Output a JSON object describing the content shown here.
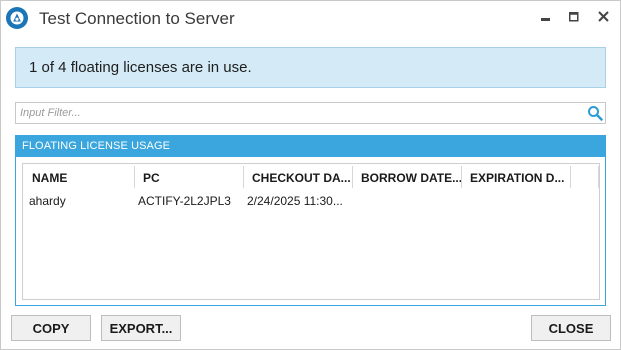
{
  "window": {
    "title": "Test Connection to Server",
    "icons": {
      "app": "actify-logo-icon",
      "minimize": "minimize-icon",
      "maximize": "maximize-icon",
      "close": "close-icon"
    }
  },
  "banner": {
    "message": "1 of 4 floating licenses are in use."
  },
  "filter": {
    "placeholder": "Input Filter...",
    "value": "",
    "icon": "search-icon"
  },
  "usage_group": {
    "title": "FLOATING LICENSE USAGE",
    "columns": [
      "NAME",
      "PC",
      "CHECKOUT DA...",
      "BORROW DATE...",
      "EXPIRATION D..."
    ],
    "rows": [
      [
        "ahardy",
        "ACTIFY-2L2JPL3",
        "2/24/2025 11:30...",
        "",
        ""
      ]
    ]
  },
  "buttons": {
    "copy": "COPY",
    "export": "EXPORT...",
    "close": "CLOSE"
  },
  "colors": {
    "accent": "#3aa6dd",
    "banner_bg": "#d4ebf7",
    "search_icon": "#2f9bd6"
  }
}
